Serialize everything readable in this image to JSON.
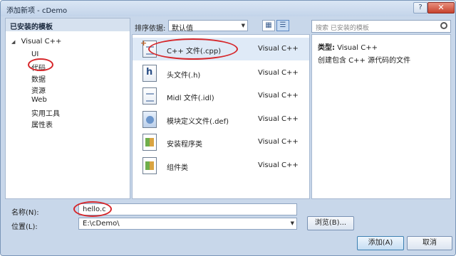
{
  "window": {
    "title": "添加新项 - cDemo",
    "help_label": "?",
    "close_label": "✕"
  },
  "left_panel": {
    "header": "已安装的模板",
    "root": "Visual C++",
    "items": [
      {
        "label": "UI"
      },
      {
        "label": "代码"
      },
      {
        "label": "数据"
      },
      {
        "label": "资源"
      },
      {
        "label": "Web"
      },
      {
        "label": "实用工具"
      },
      {
        "label": "属性表"
      }
    ]
  },
  "toolbar": {
    "sort_label": "排序依据:",
    "sort_value": "默认值",
    "search_placeholder": "搜索 已安装的模板"
  },
  "templates": [
    {
      "name": "C++ 文件(.cpp)",
      "type": "Visual C++",
      "icon": "cpp-file-icon"
    },
    {
      "name": "头文件(.h)",
      "type": "Visual C++",
      "icon": "header-file-icon"
    },
    {
      "name": "Midl 文件(.idl)",
      "type": "Visual C++",
      "icon": "idl-file-icon"
    },
    {
      "name": "模块定义文件(.def)",
      "type": "Visual C++",
      "icon": "def-file-icon"
    },
    {
      "name": "安装程序类",
      "type": "Visual C++",
      "icon": "installer-class-icon"
    },
    {
      "name": "组件类",
      "type": "Visual C++",
      "icon": "component-class-icon"
    }
  ],
  "info": {
    "type_label": "类型:",
    "type_value": "Visual C++",
    "description": "创建包含 C++ 源代码的文件"
  },
  "form": {
    "name_label": "名称(N):",
    "name_value": "hello.c",
    "location_label": "位置(L):",
    "location_value": "E:\\cDemo\\",
    "browse_label": "浏览(B)...",
    "add_label": "添加(A)",
    "cancel_label": "取消"
  },
  "colors": {
    "annotation": "#d6262a",
    "selection": "#dfeaf7",
    "chrome": "#c8d7ea"
  }
}
